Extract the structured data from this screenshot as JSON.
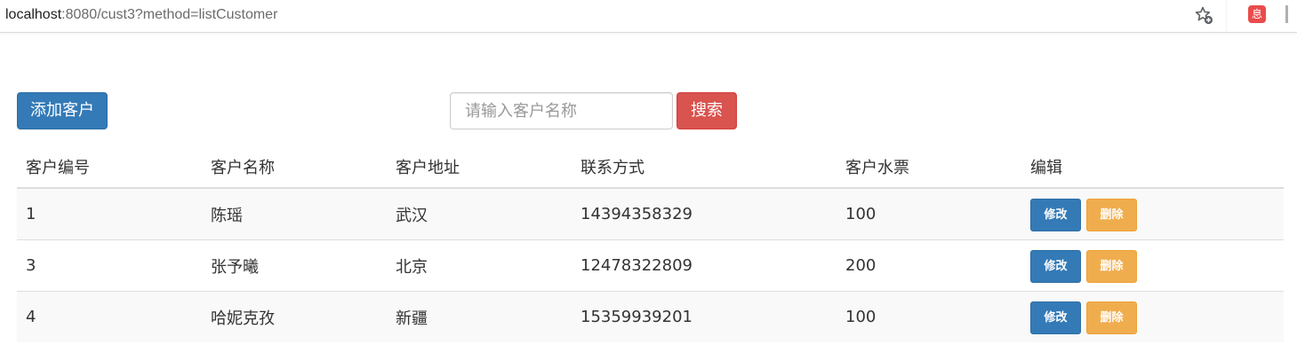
{
  "browser": {
    "url_host": "localhost",
    "url_path": ":8080/cust3?method=listCustomer",
    "bookmark_icon": "star-add-icon",
    "extension_icon_label": "息",
    "extension_icon_color": "#ea4b4b"
  },
  "toolbar": {
    "add_label": "添加客户",
    "search_placeholder": "请输入客户名称",
    "search_value": "",
    "search_label": "搜索"
  },
  "colors": {
    "primary": "#337ab7",
    "danger": "#d9534f",
    "warning": "#f0ad4e"
  },
  "table": {
    "headers": [
      "客户编号",
      "客户名称",
      "客户地址",
      "联系方式",
      "客户水票",
      "编辑"
    ],
    "rows": [
      {
        "id": "1",
        "name": "陈瑶",
        "address": "武汉",
        "phone": "14394358329",
        "tickets": "100",
        "edit_label": "修改",
        "delete_label": "删除"
      },
      {
        "id": "3",
        "name": "张予曦",
        "address": "北京",
        "phone": "12478322809",
        "tickets": "200",
        "edit_label": "修改",
        "delete_label": "删除"
      },
      {
        "id": "4",
        "name": "哈妮克孜",
        "address": "新疆",
        "phone": "15359939201",
        "tickets": "100",
        "edit_label": "修改",
        "delete_label": "删除"
      }
    ]
  }
}
